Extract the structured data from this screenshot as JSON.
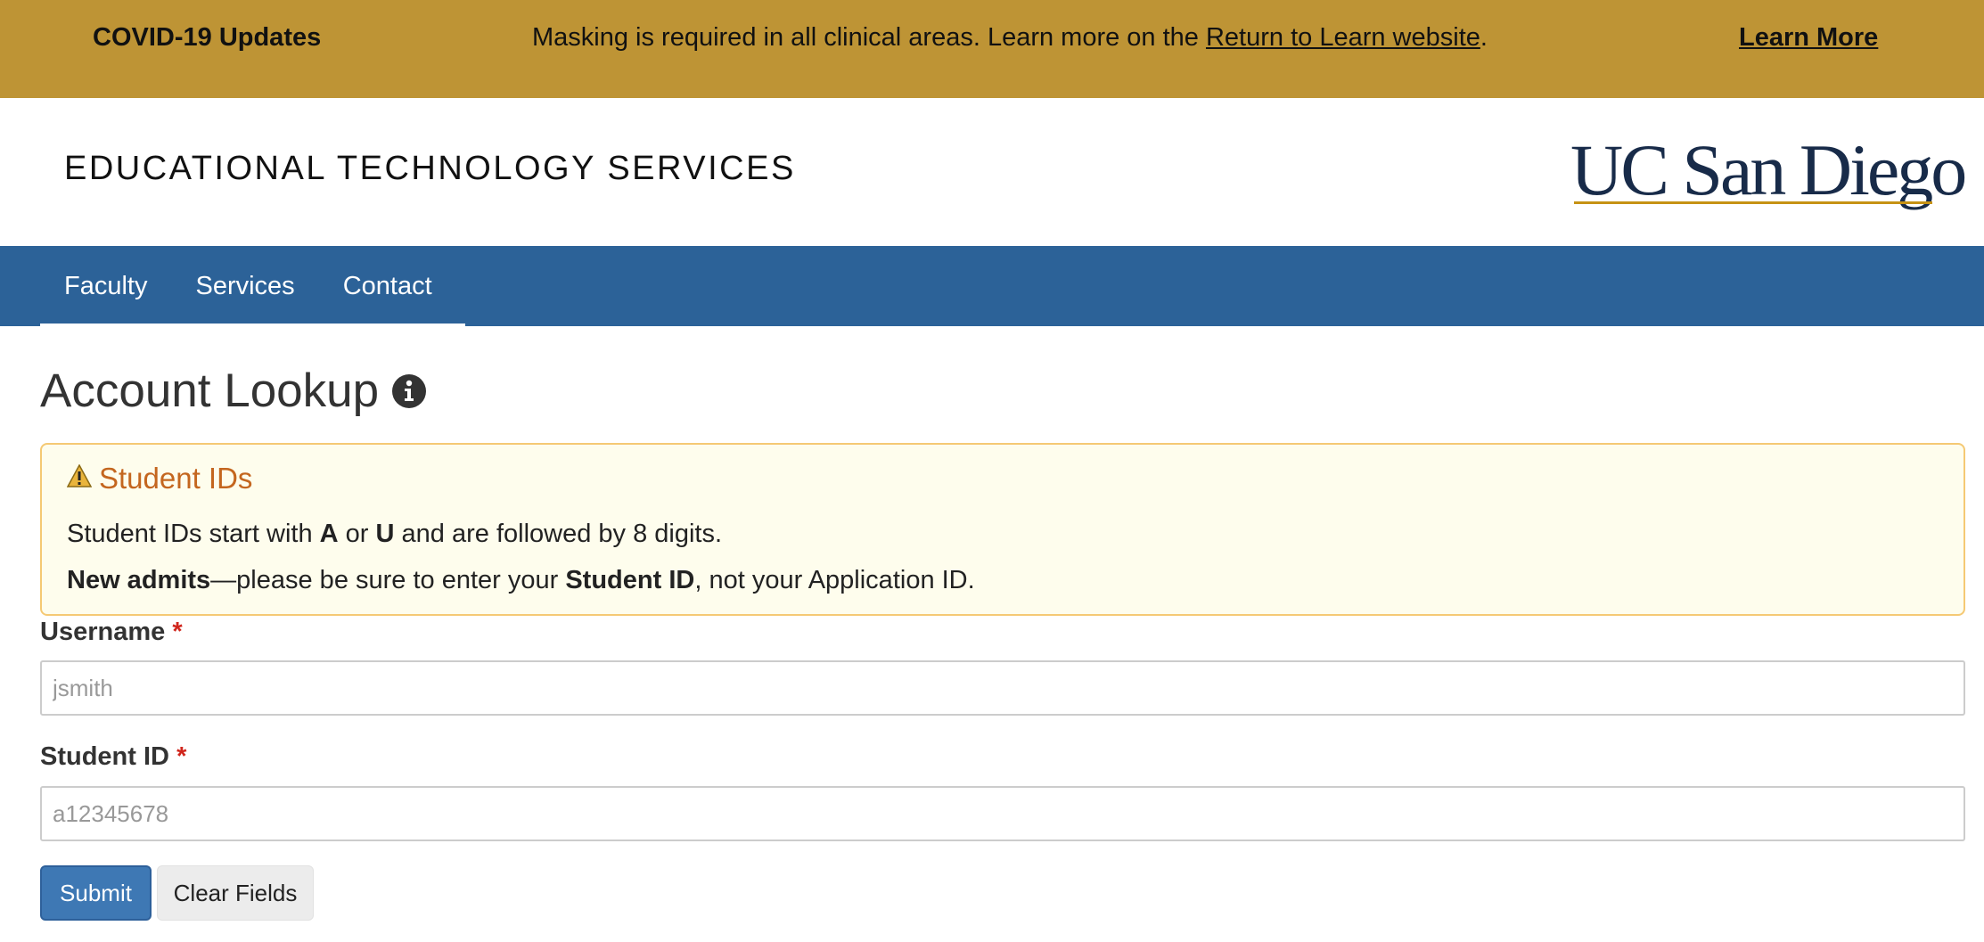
{
  "covid": {
    "title": "COVID-19 Updates",
    "message_pre": "Masking is required in all clinical areas. Learn more on the ",
    "message_link": "Return to Learn website",
    "message_post": ".",
    "learn_more": "Learn More"
  },
  "header": {
    "site_title": "EDUCATIONAL TECHNOLOGY SERVICES",
    "logo_text": "UC San Diego"
  },
  "nav": {
    "items": [
      "Faculty",
      "Services",
      "Contact"
    ]
  },
  "page": {
    "title": "Account Lookup"
  },
  "alert": {
    "title": "Student IDs",
    "line1_pre": "Student IDs start with ",
    "line1_a": "A",
    "line1_or": " or ",
    "line1_u": "U",
    "line1_post": " and are followed by 8 digits.",
    "line2_bold1": "New admits",
    "line2_mid": "—please be sure to enter your ",
    "line2_bold2": "Student ID",
    "line2_post": ", not your Application ID."
  },
  "form": {
    "username_label": "Username",
    "username_placeholder": "jsmith",
    "studentid_label": "Student ID",
    "studentid_placeholder": "a12345678",
    "required_mark": "*",
    "submit_label": "Submit",
    "clear_label": "Clear Fields"
  },
  "colors": {
    "banner": "#be9435",
    "nav": "#2c6298",
    "alert_bg": "#fefded",
    "alert_title": "#c4661f",
    "submit": "#3e78b4"
  },
  "icons": {
    "title_icon": "info-circle-icon",
    "alert_icon": "warning-triangle-icon"
  }
}
